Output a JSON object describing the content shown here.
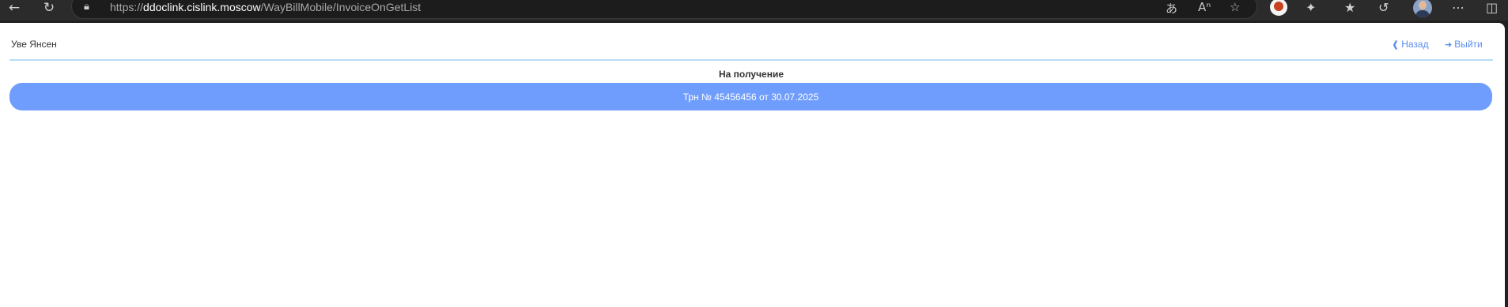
{
  "browser": {
    "url_prefix": "https://",
    "url_host": "ddoclink.cislink.moscow",
    "url_path": "/WayBillMobile/InvoiceOnGetList",
    "icons": {
      "back": "arrow-left-icon",
      "reload": "reload-icon",
      "lock": "lock-icon",
      "translate": "translate-icon",
      "read_aloud": "read-aloud-icon",
      "favorite": "star-icon",
      "extension": "extension-icon",
      "extensions": "puzzle-icon",
      "favorites": "favorites-icon",
      "history": "history-icon",
      "profile": "profile-avatar",
      "more": "more-icon",
      "sidebar": "sidebar-icon"
    }
  },
  "header": {
    "username": "Уве Янсен",
    "back_label": "Назад",
    "logout_label": "Выйти"
  },
  "main": {
    "section_title": "На получение",
    "invoices": [
      {
        "label": "Трн № 45456456 от 30.07.2025"
      }
    ]
  },
  "colors": {
    "accent": "#6f9dfd",
    "link": "#5b8def",
    "divider": "#b9dcf6"
  }
}
